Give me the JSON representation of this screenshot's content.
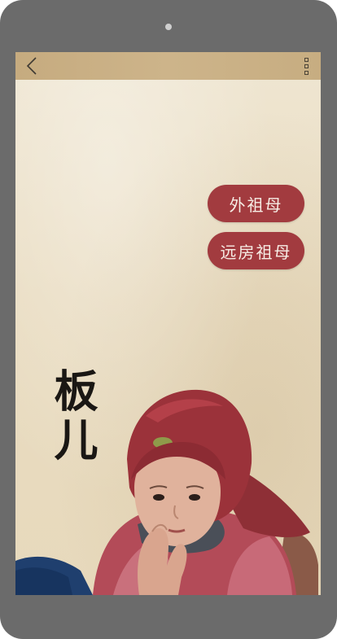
{
  "header": {
    "back_icon": "chevron-left-icon",
    "menu_icon": "more-vertical-icon"
  },
  "relations": [
    {
      "label": "外祖母"
    },
    {
      "label": "远房祖母"
    }
  ],
  "term": {
    "title": "板儿"
  },
  "colors": {
    "frame": "#6b6b6b",
    "topbar": "#c9af83",
    "paper": "#ebdfc6",
    "pill": "#a23b3f",
    "pill_text": "#f7eee6",
    "title_text": "#1a1714"
  }
}
